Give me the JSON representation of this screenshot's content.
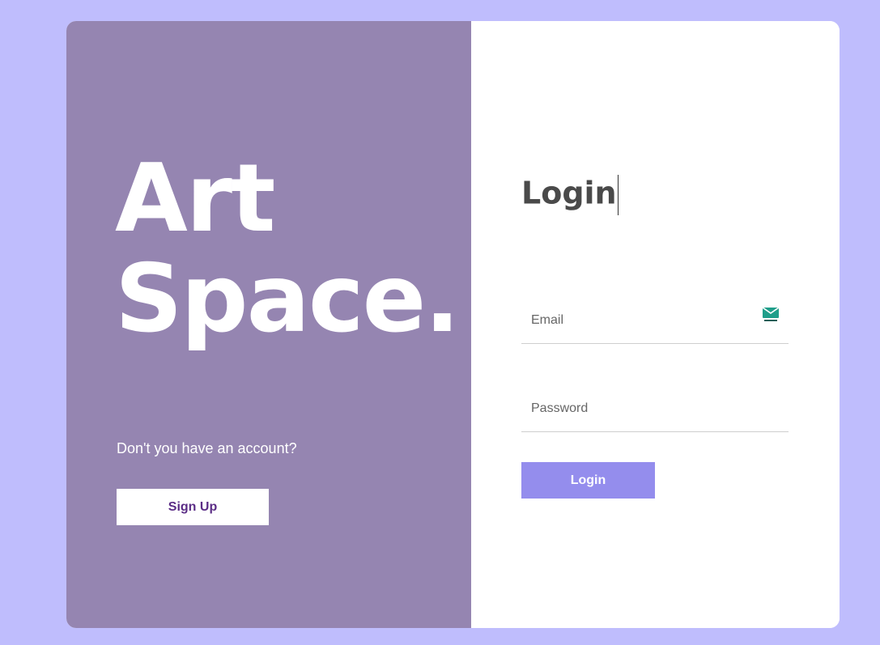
{
  "brand": {
    "line1": "Art",
    "line2": "Space."
  },
  "signup": {
    "prompt": "Don't you have an account?",
    "button_label": "Sign Up"
  },
  "login": {
    "title": "Login",
    "email_placeholder": "Email",
    "password_placeholder": "Password",
    "button_label": "Login"
  },
  "icons": {
    "email_field_icon": "envelope-icon"
  },
  "colors": {
    "page_background": "#bfbdfd",
    "left_panel": "#9585b1",
    "login_button": "#948ded",
    "signup_text": "#5b2d86"
  }
}
